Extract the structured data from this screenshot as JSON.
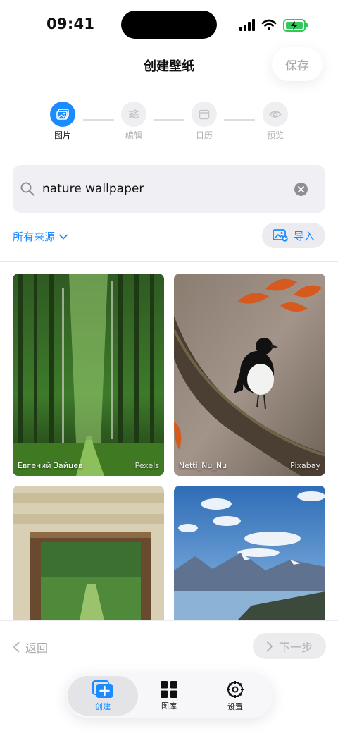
{
  "status_bar": {
    "time": "09:41"
  },
  "header": {
    "title": "创建壁纸",
    "save_label": "保存"
  },
  "stepper": {
    "steps": [
      {
        "label": "图片",
        "icon": "image-icon",
        "active": true
      },
      {
        "label": "编辑",
        "icon": "sliders-icon",
        "active": false
      },
      {
        "label": "日历",
        "icon": "calendar-icon",
        "active": false
      },
      {
        "label": "预览",
        "icon": "eye-icon",
        "active": false
      }
    ]
  },
  "search": {
    "value": "nature wallpaper",
    "icon": "search-icon"
  },
  "filters": {
    "source_label": "所有来源",
    "import_label": "导入"
  },
  "results": [
    {
      "author": "Евгений Зайцев",
      "source": "Pexels",
      "subject": "forest path"
    },
    {
      "author": "Netti_Nu_Nu",
      "source": "Pixabay",
      "subject": "magpie on branch"
    },
    {
      "author": "",
      "source": "",
      "subject": "wooden doorway"
    },
    {
      "author": "",
      "source": "",
      "subject": "mountain lake"
    }
  ],
  "footer": {
    "back_label": "返回",
    "next_label": "下一步"
  },
  "tabs": [
    {
      "label": "创建",
      "icon": "create-icon",
      "active": true
    },
    {
      "label": "图库",
      "icon": "gallery-grid-icon",
      "active": false
    },
    {
      "label": "设置",
      "icon": "settings-gear-icon",
      "active": false
    }
  ],
  "colors": {
    "accent": "#1a8cff",
    "disabled": "#b0b0b5",
    "search_bg": "#f0f0f4"
  }
}
